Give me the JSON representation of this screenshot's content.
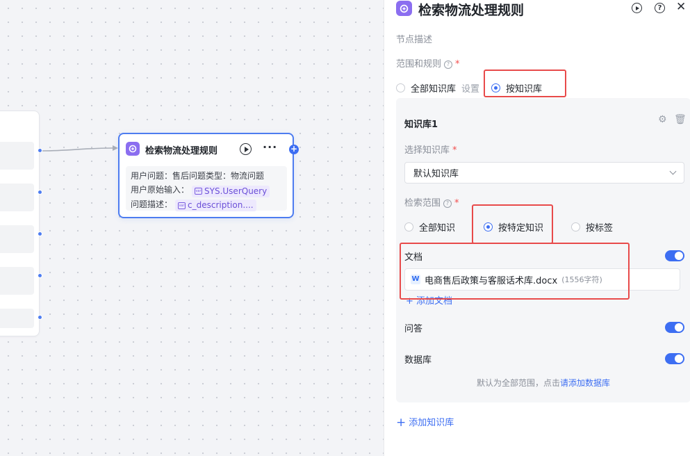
{
  "canvas": {
    "node": {
      "title": "检索物流处理规则",
      "more_label": "···",
      "add_label": "+",
      "lines": [
        {
          "text": "用户问题：售后问题类型：物流问题"
        },
        {
          "label": "用户原始输入：",
          "var": "SYS.UserQuery"
        },
        {
          "label": "问题描述：",
          "var": "c_description...."
        }
      ]
    }
  },
  "panel": {
    "title": "检索物流处理规则",
    "help_label": "?",
    "close_label": "✕",
    "node_desc_label": "节点描述",
    "scope_rule_label": "范围和规则",
    "scope_options": {
      "all": "全部知识库",
      "settings": "设置",
      "by_kb": "按知识库",
      "selected": "按知识库"
    },
    "kb": {
      "title": "知识库1",
      "gear": "⚙",
      "trash": "🗑",
      "select_label": "选择知识库",
      "select_value": "默认知识库",
      "search_range_label": "检索范围",
      "range_options": {
        "all": "全部知识",
        "specific": "按特定知识",
        "tag": "按标签"
      },
      "range_selected": "按特定知识",
      "sections": {
        "doc": {
          "label": "文档",
          "enabled": true
        },
        "qa": {
          "label": "问答",
          "enabled": true
        },
        "db": {
          "label": "数据库",
          "enabled": true
        }
      },
      "doc_file": {
        "icon": "W",
        "name": "电商售后政策与客服话术库.docx",
        "count": "(1556字符)"
      },
      "add_doc": "+ 添加文档",
      "hint_text": "默认为全部范围，点击",
      "hint_link": "请添加数据库"
    },
    "add_kb": "添加知识库"
  },
  "colors": {
    "accent": "#3d6ef2",
    "node_purple": "#8b6ef0",
    "highlight_red": "#e84a4a"
  }
}
